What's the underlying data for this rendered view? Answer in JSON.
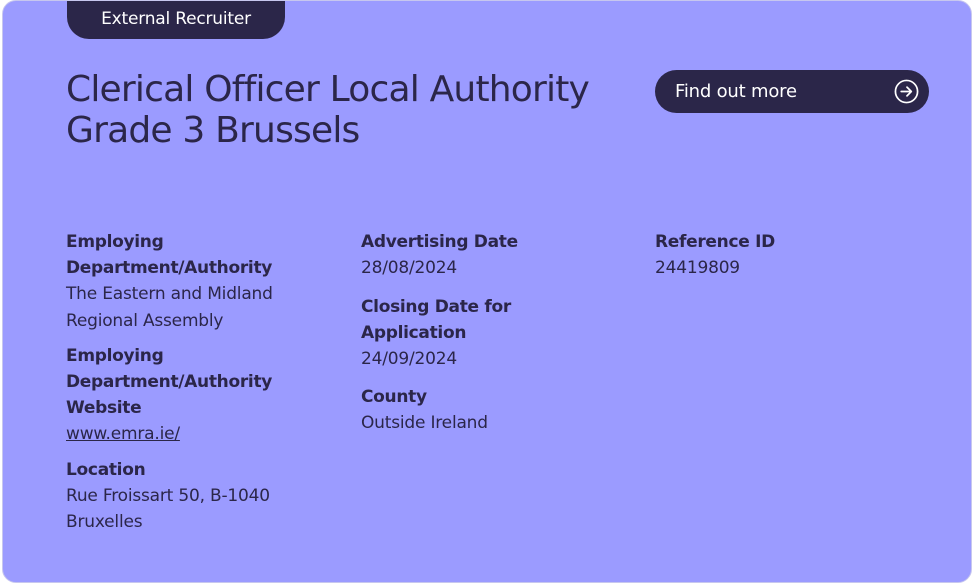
{
  "card": {
    "tag_label": "External Recruiter",
    "title": "Clerical Officer Local Authority Grade 3 Brussels",
    "cta_label": "Find out more",
    "cta_icon": "arrow-right-circle-icon",
    "colors": {
      "background": "#9b9bff",
      "dark": "#2b2649",
      "light_text": "#ffffff"
    }
  },
  "details": {
    "employing_department": {
      "label": "Employing Department/Authority",
      "value": "The Eastern and Midland Regional Assembly"
    },
    "employing_department_website": {
      "label": "Employing Department/Authority Website",
      "value": "www.emra.ie/"
    },
    "location": {
      "label": "Location",
      "value": "Rue Froissart 50, B-1040 Bruxelles"
    },
    "advertising_date": {
      "label": "Advertising Date",
      "value": "28/08/2024"
    },
    "closing_date": {
      "label": "Closing Date for Application",
      "value": "24/09/2024"
    },
    "county": {
      "label": "County",
      "value": "Outside Ireland"
    },
    "reference_id": {
      "label": "Reference ID",
      "value": "24419809"
    }
  }
}
